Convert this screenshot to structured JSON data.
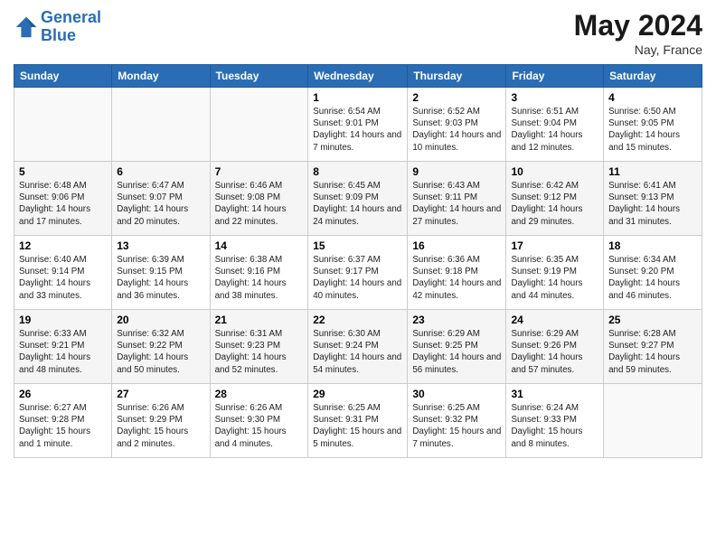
{
  "header": {
    "logo_line1": "General",
    "logo_line2": "Blue",
    "month": "May 2024",
    "location": "Nay, France"
  },
  "days_of_week": [
    "Sunday",
    "Monday",
    "Tuesday",
    "Wednesday",
    "Thursday",
    "Friday",
    "Saturday"
  ],
  "weeks": [
    [
      {
        "day": "",
        "info": ""
      },
      {
        "day": "",
        "info": ""
      },
      {
        "day": "",
        "info": ""
      },
      {
        "day": "1",
        "info": "Sunrise: 6:54 AM\nSunset: 9:01 PM\nDaylight: 14 hours and 7 minutes."
      },
      {
        "day": "2",
        "info": "Sunrise: 6:52 AM\nSunset: 9:03 PM\nDaylight: 14 hours and 10 minutes."
      },
      {
        "day": "3",
        "info": "Sunrise: 6:51 AM\nSunset: 9:04 PM\nDaylight: 14 hours and 12 minutes."
      },
      {
        "day": "4",
        "info": "Sunrise: 6:50 AM\nSunset: 9:05 PM\nDaylight: 14 hours and 15 minutes."
      }
    ],
    [
      {
        "day": "5",
        "info": "Sunrise: 6:48 AM\nSunset: 9:06 PM\nDaylight: 14 hours and 17 minutes."
      },
      {
        "day": "6",
        "info": "Sunrise: 6:47 AM\nSunset: 9:07 PM\nDaylight: 14 hours and 20 minutes."
      },
      {
        "day": "7",
        "info": "Sunrise: 6:46 AM\nSunset: 9:08 PM\nDaylight: 14 hours and 22 minutes."
      },
      {
        "day": "8",
        "info": "Sunrise: 6:45 AM\nSunset: 9:09 PM\nDaylight: 14 hours and 24 minutes."
      },
      {
        "day": "9",
        "info": "Sunrise: 6:43 AM\nSunset: 9:11 PM\nDaylight: 14 hours and 27 minutes."
      },
      {
        "day": "10",
        "info": "Sunrise: 6:42 AM\nSunset: 9:12 PM\nDaylight: 14 hours and 29 minutes."
      },
      {
        "day": "11",
        "info": "Sunrise: 6:41 AM\nSunset: 9:13 PM\nDaylight: 14 hours and 31 minutes."
      }
    ],
    [
      {
        "day": "12",
        "info": "Sunrise: 6:40 AM\nSunset: 9:14 PM\nDaylight: 14 hours and 33 minutes."
      },
      {
        "day": "13",
        "info": "Sunrise: 6:39 AM\nSunset: 9:15 PM\nDaylight: 14 hours and 36 minutes."
      },
      {
        "day": "14",
        "info": "Sunrise: 6:38 AM\nSunset: 9:16 PM\nDaylight: 14 hours and 38 minutes."
      },
      {
        "day": "15",
        "info": "Sunrise: 6:37 AM\nSunset: 9:17 PM\nDaylight: 14 hours and 40 minutes."
      },
      {
        "day": "16",
        "info": "Sunrise: 6:36 AM\nSunset: 9:18 PM\nDaylight: 14 hours and 42 minutes."
      },
      {
        "day": "17",
        "info": "Sunrise: 6:35 AM\nSunset: 9:19 PM\nDaylight: 14 hours and 44 minutes."
      },
      {
        "day": "18",
        "info": "Sunrise: 6:34 AM\nSunset: 9:20 PM\nDaylight: 14 hours and 46 minutes."
      }
    ],
    [
      {
        "day": "19",
        "info": "Sunrise: 6:33 AM\nSunset: 9:21 PM\nDaylight: 14 hours and 48 minutes."
      },
      {
        "day": "20",
        "info": "Sunrise: 6:32 AM\nSunset: 9:22 PM\nDaylight: 14 hours and 50 minutes."
      },
      {
        "day": "21",
        "info": "Sunrise: 6:31 AM\nSunset: 9:23 PM\nDaylight: 14 hours and 52 minutes."
      },
      {
        "day": "22",
        "info": "Sunrise: 6:30 AM\nSunset: 9:24 PM\nDaylight: 14 hours and 54 minutes."
      },
      {
        "day": "23",
        "info": "Sunrise: 6:29 AM\nSunset: 9:25 PM\nDaylight: 14 hours and 56 minutes."
      },
      {
        "day": "24",
        "info": "Sunrise: 6:29 AM\nSunset: 9:26 PM\nDaylight: 14 hours and 57 minutes."
      },
      {
        "day": "25",
        "info": "Sunrise: 6:28 AM\nSunset: 9:27 PM\nDaylight: 14 hours and 59 minutes."
      }
    ],
    [
      {
        "day": "26",
        "info": "Sunrise: 6:27 AM\nSunset: 9:28 PM\nDaylight: 15 hours and 1 minute."
      },
      {
        "day": "27",
        "info": "Sunrise: 6:26 AM\nSunset: 9:29 PM\nDaylight: 15 hours and 2 minutes."
      },
      {
        "day": "28",
        "info": "Sunrise: 6:26 AM\nSunset: 9:30 PM\nDaylight: 15 hours and 4 minutes."
      },
      {
        "day": "29",
        "info": "Sunrise: 6:25 AM\nSunset: 9:31 PM\nDaylight: 15 hours and 5 minutes."
      },
      {
        "day": "30",
        "info": "Sunrise: 6:25 AM\nSunset: 9:32 PM\nDaylight: 15 hours and 7 minutes."
      },
      {
        "day": "31",
        "info": "Sunrise: 6:24 AM\nSunset: 9:33 PM\nDaylight: 15 hours and 8 minutes."
      },
      {
        "day": "",
        "info": ""
      }
    ]
  ]
}
